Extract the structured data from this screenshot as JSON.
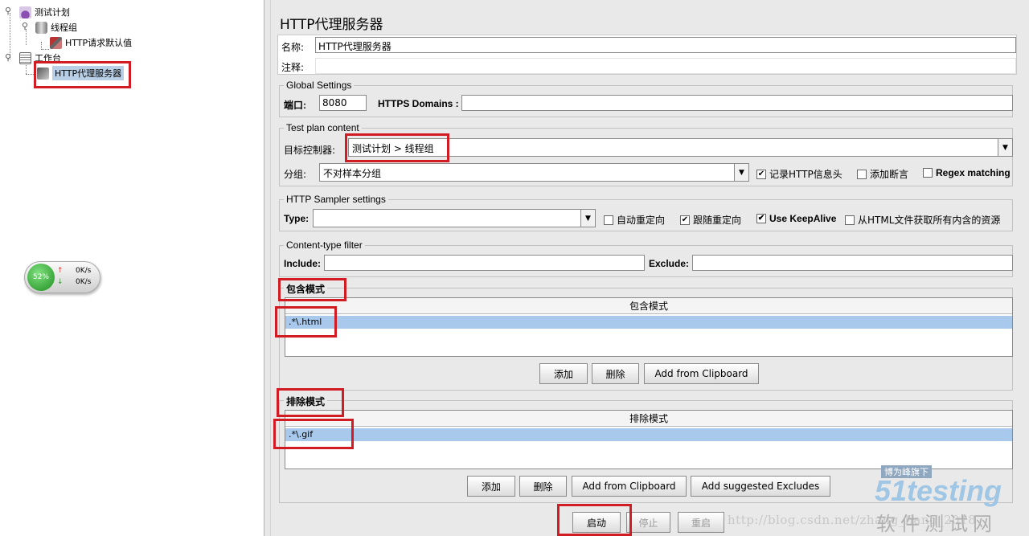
{
  "tree": {
    "items": [
      {
        "label": "测试计划",
        "icon": "flask-icon"
      },
      {
        "label": "线程组",
        "icon": "spool-icon"
      },
      {
        "label": "HTTP请求默认值",
        "icon": "hammer-icon"
      },
      {
        "label": "工作台",
        "icon": "clipboard-icon"
      },
      {
        "label": "HTTP代理服务器",
        "icon": "proxy-icon"
      }
    ]
  },
  "network_widget": {
    "percent": "52%",
    "up": "0K/s",
    "down": "0K/s"
  },
  "panel": {
    "title": "HTTP代理服务器",
    "name_label": "名称:",
    "name_value": "HTTP代理服务器",
    "comment_label": "注释:",
    "comment_value": "",
    "global": {
      "title": "Global Settings",
      "port_label": "端口:",
      "port_value": "8080",
      "https_label": "HTTPS Domains :",
      "https_value": ""
    },
    "test_plan": {
      "title": "Test plan content",
      "target_label": "目标控制器:",
      "target_value": "测试计划 > 线程组",
      "group_label": "分组:",
      "group_value": "不对样本分组",
      "options": [
        {
          "label": "记录HTTP信息头",
          "checked": true
        },
        {
          "label": "添加断言",
          "checked": false
        },
        {
          "label": "Regex matching",
          "checked": false
        }
      ]
    },
    "sampler": {
      "title": "HTTP Sampler settings",
      "type_label": "Type:",
      "type_value": "",
      "options": [
        {
          "label": "自动重定向",
          "checked": false
        },
        {
          "label": "跟随重定向",
          "checked": true
        },
        {
          "label": "Use KeepAlive",
          "checked": true
        },
        {
          "label": "从HTML文件获取所有内含的资源",
          "checked": false
        }
      ]
    },
    "content_filter": {
      "title": "Content-type filter",
      "include_label": "Include:",
      "include_value": "",
      "exclude_label": "Exclude:",
      "exclude_value": ""
    },
    "include_patterns": {
      "title": "包含模式",
      "column": "包含模式",
      "rows": [
        ".*\\.html"
      ],
      "buttons": [
        "添加",
        "删除",
        "Add from Clipboard"
      ]
    },
    "exclude_patterns": {
      "title": "排除模式",
      "column": "排除模式",
      "rows": [
        ".*\\.gif"
      ],
      "buttons": [
        "添加",
        "删除",
        "Add from Clipboard",
        "Add suggested Excludes"
      ]
    },
    "controls": {
      "start": "启动",
      "stop": "停止",
      "restart": "重启"
    }
  },
  "watermark": {
    "url": "http://blog.csdn.net/zhang_liang_2018",
    "logo": "51testing",
    "slogan": "博为峰旗下",
    "cn": "软件测试网"
  },
  "colors": {
    "highlight": "#d11c24",
    "selection": "#a8c8ec",
    "panel_bg": "#e9e9e9"
  }
}
